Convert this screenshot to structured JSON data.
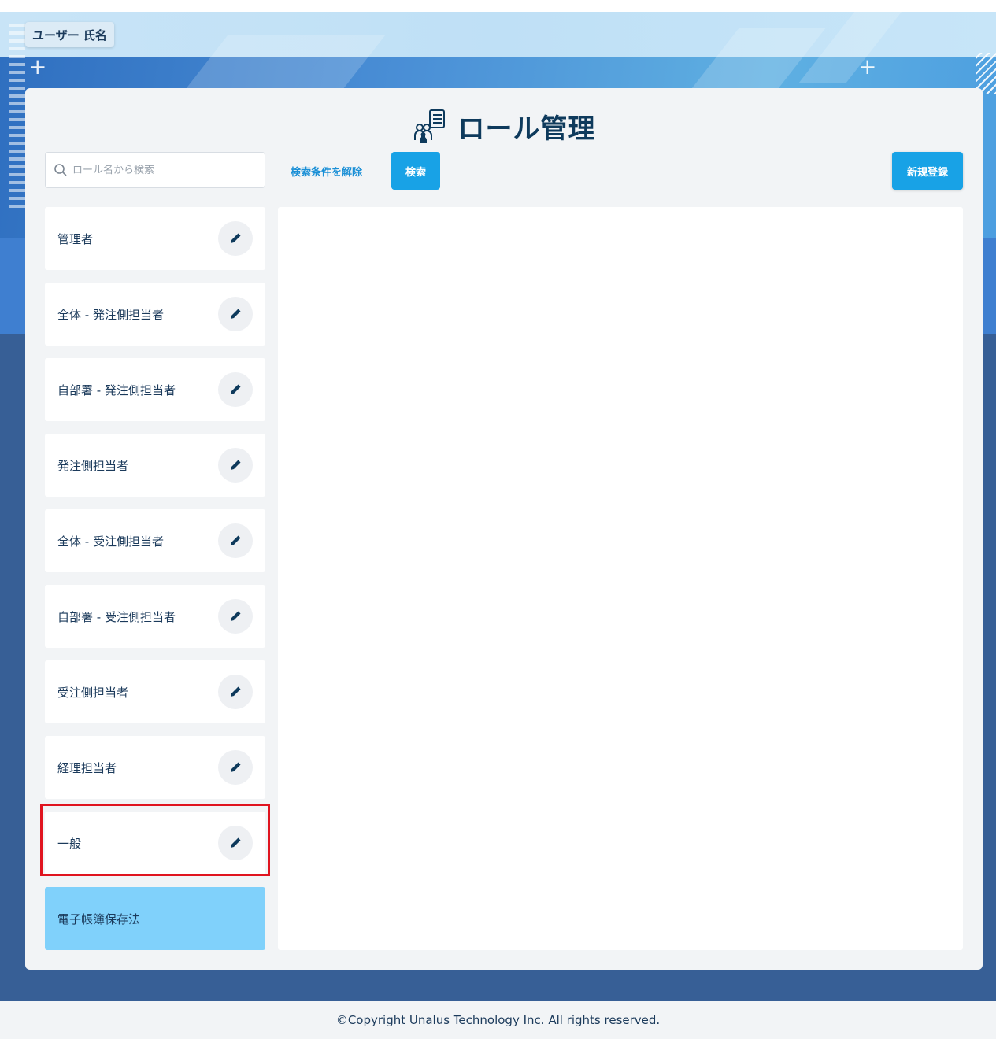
{
  "header": {
    "user_name": "ユーザー 氏名"
  },
  "page": {
    "title": "ロール管理",
    "title_icon": "role-management-icon"
  },
  "toolbar": {
    "search_placeholder": "ロール名から検索",
    "search_value": "",
    "clear_label": "検索条件を解除",
    "search_button_label": "検索",
    "new_button_label": "新規登録"
  },
  "roles": [
    {
      "label": "管理者",
      "editable": true,
      "selected": false
    },
    {
      "label": "全体 - 発注側担当者",
      "editable": true,
      "selected": false
    },
    {
      "label": "自部署 - 発注側担当者",
      "editable": true,
      "selected": false
    },
    {
      "label": "発注側担当者",
      "editable": true,
      "selected": false
    },
    {
      "label": "全体 - 受注側担当者",
      "editable": true,
      "selected": false
    },
    {
      "label": "自部署 - 受注側担当者",
      "editable": true,
      "selected": false
    },
    {
      "label": "受注側担当者",
      "editable": true,
      "selected": false
    },
    {
      "label": "経理担当者",
      "editable": true,
      "selected": false
    },
    {
      "label": "一般",
      "editable": true,
      "selected": false,
      "highlighted": true
    },
    {
      "label": "電子帳簿保存法",
      "editable": false,
      "selected": true
    }
  ],
  "colors": {
    "accent": "#18a2e6",
    "selected_row": "#80d1fb",
    "highlight_border": "#e0141f",
    "title_text": "#0e3a5c"
  },
  "footer": {
    "copyright": "©Copyright Unalus Technology Inc. All rights reserved."
  }
}
